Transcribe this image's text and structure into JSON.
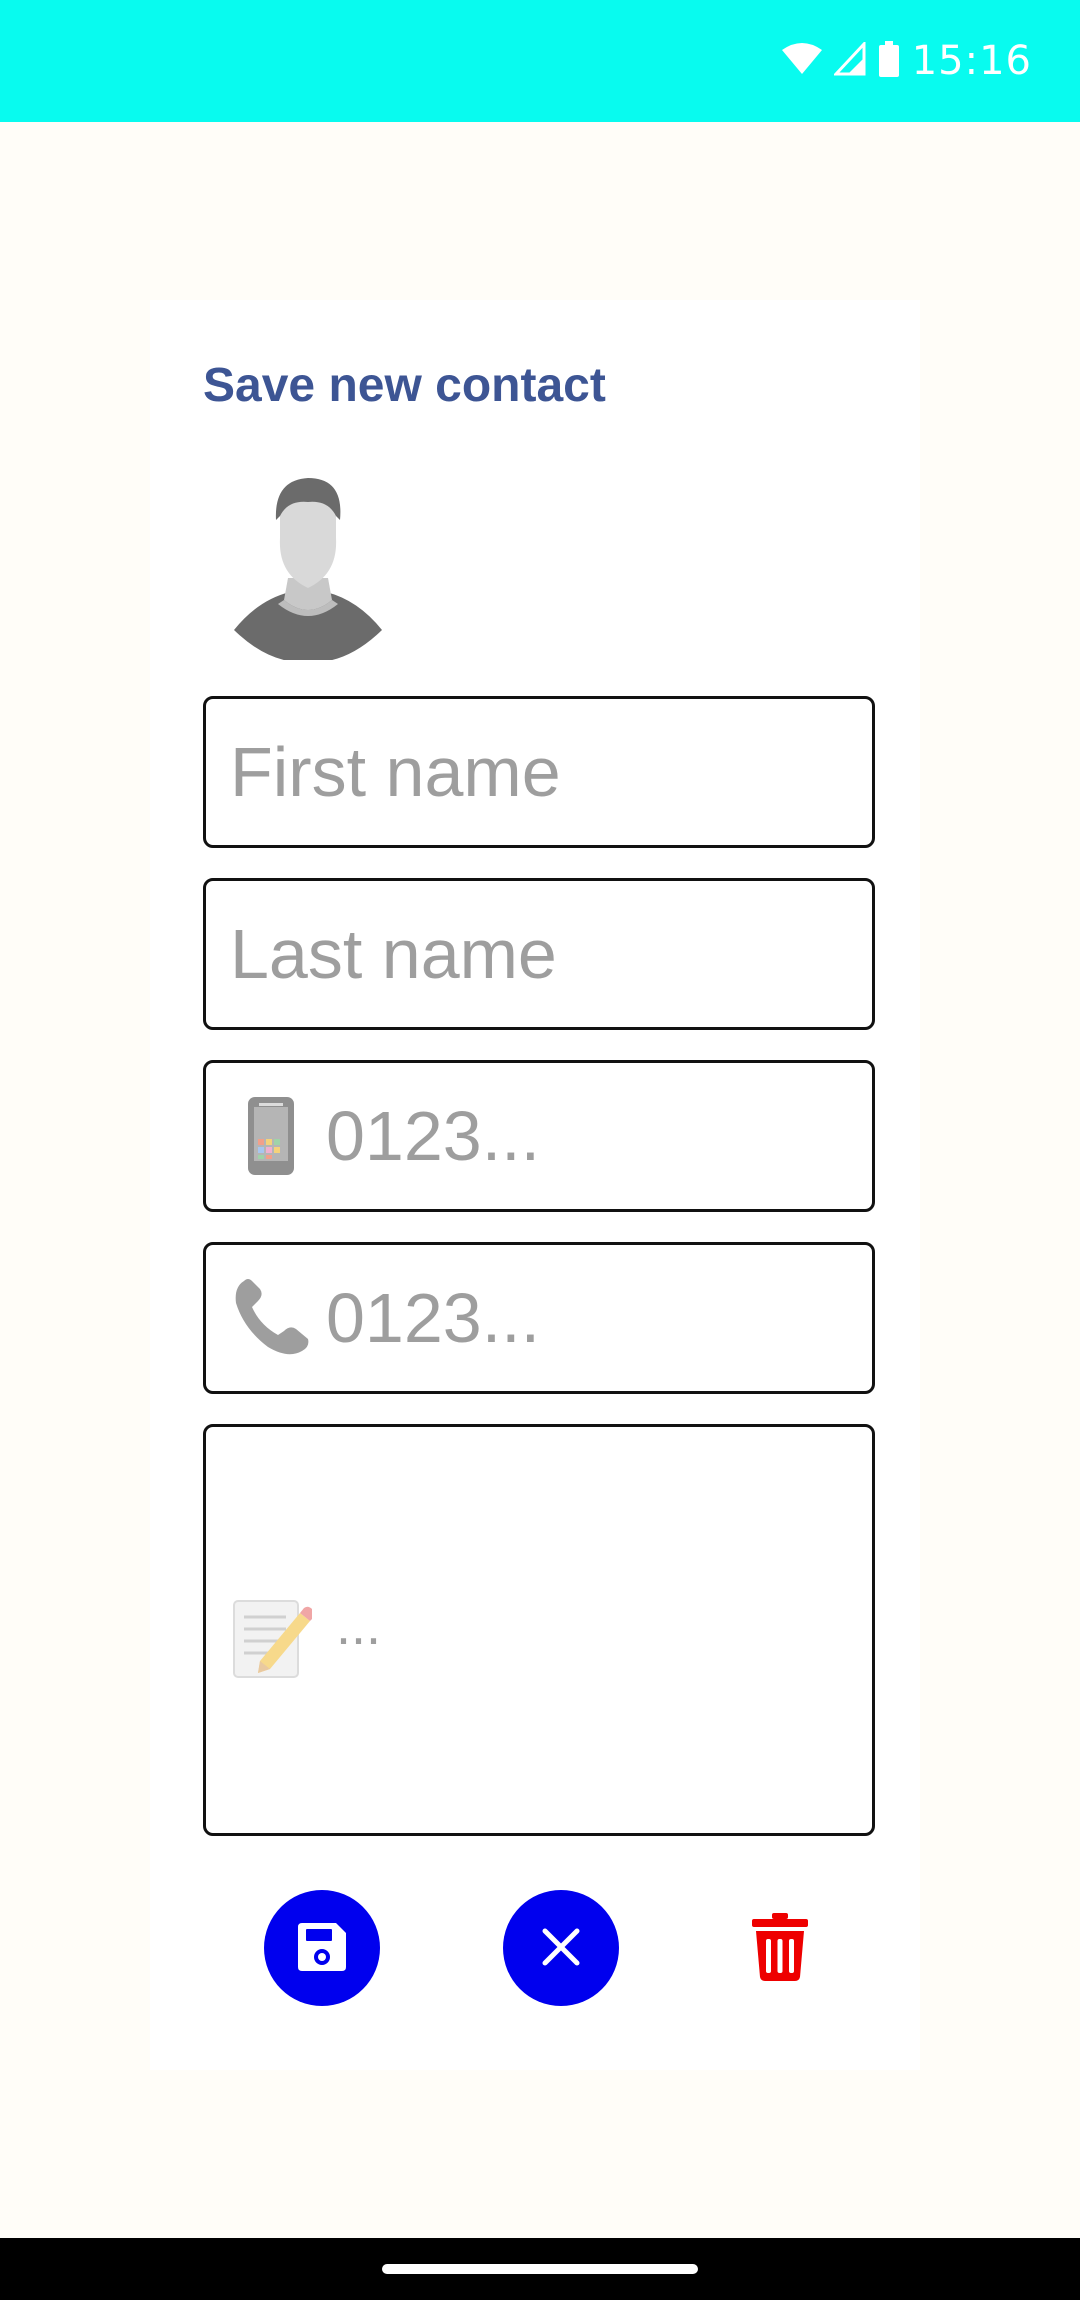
{
  "status_bar": {
    "time": "15:16",
    "icons": [
      "wifi-icon",
      "signal-icon",
      "battery-icon"
    ],
    "background": "#08fbef"
  },
  "form": {
    "title": "Save new contact",
    "avatar_icon": "person-avatar-icon",
    "first_name": {
      "placeholder": "First name",
      "value": ""
    },
    "last_name": {
      "placeholder": "Last name",
      "value": ""
    },
    "mobile": {
      "icon": "mobile-phone-icon",
      "placeholder": "0123...",
      "value": ""
    },
    "phone": {
      "icon": "telephone-icon",
      "placeholder": "0123...",
      "value": ""
    },
    "notes": {
      "icon": "memo-pencil-icon",
      "placeholder": "...",
      "value": ""
    }
  },
  "actions": {
    "save_icon": "save-icon",
    "cancel_icon": "close-icon",
    "delete_icon": "trash-icon"
  },
  "colors": {
    "accent": "#0000ee",
    "title": "#3d5594",
    "delete": "#ee0000",
    "background": "#fffdf8"
  }
}
